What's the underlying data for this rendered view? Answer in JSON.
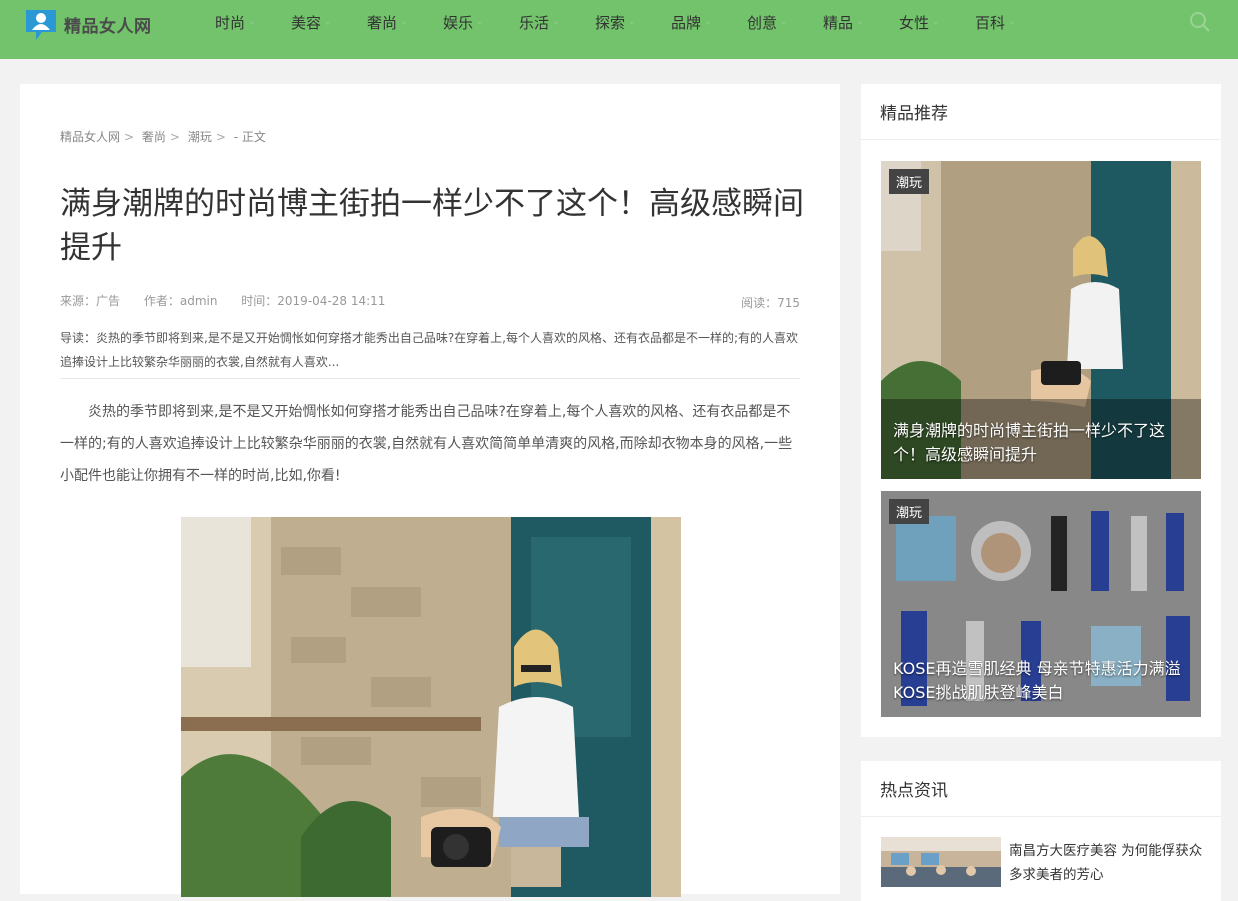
{
  "header": {
    "logo_text": "精品女人网",
    "nav": [
      {
        "label": "时尚"
      },
      {
        "label": "美容"
      },
      {
        "label": "奢尚"
      },
      {
        "label": "娱乐"
      },
      {
        "label": "乐活"
      },
      {
        "label": "探索"
      },
      {
        "label": "品牌"
      },
      {
        "label": "创意"
      },
      {
        "label": "精品"
      },
      {
        "label": "女性"
      },
      {
        "label": "百科"
      }
    ],
    "search_icon": "search-icon",
    "colors": {
      "bar": "#72c36b"
    }
  },
  "breadcrumb": {
    "items": [
      "精品女人网",
      "奢尚",
      "潮玩"
    ],
    "separator": ">",
    "current": "- 正文"
  },
  "article": {
    "title": "满身潮牌的时尚博主街拍一样少不了这个！高级感瞬间提升",
    "source": "来源：广告",
    "author": "作者：admin",
    "time": "时间：2019-04-28 14:11",
    "reads": "阅读：715",
    "summary": "导读：炎热的季节即将到来,是不是又开始惆怅如何穿搭才能秀出自己品味?在穿着上,每个人喜欢的风格、还有衣品都是不一样的;有的人喜欢追捧设计上比较繁杂华丽丽的衣裳,自然就有人喜欢...",
    "body": "炎热的季节即将到来,是不是又开始惆怅如何穿搭才能秀出自己品味?在穿着上,每个人喜欢的风格、还有衣品都是不一样的;有的人喜欢追捧设计上比较繁杂华丽丽的衣裳,自然就有人喜欢简简单单清爽的风格,而除却衣物本身的风格,一些小配件也能让你拥有不一样的时尚,比如,你看!"
  },
  "sidebar": {
    "recommend_title": "精品推荐",
    "recommend": [
      {
        "tag": "潮玩",
        "caption": "满身潮牌的时尚博主街拍一样少不了这个！高级感瞬间提升"
      },
      {
        "tag": "潮玩",
        "caption": "KOSE再造雪肌经典 母亲节特惠活力满溢KOSE挑战肌肤登峰美白"
      }
    ],
    "hot_title": "热点资讯",
    "hot": [
      {
        "title": "南昌方大医疗美容 为何能俘获众多求美者的芳心"
      }
    ]
  }
}
